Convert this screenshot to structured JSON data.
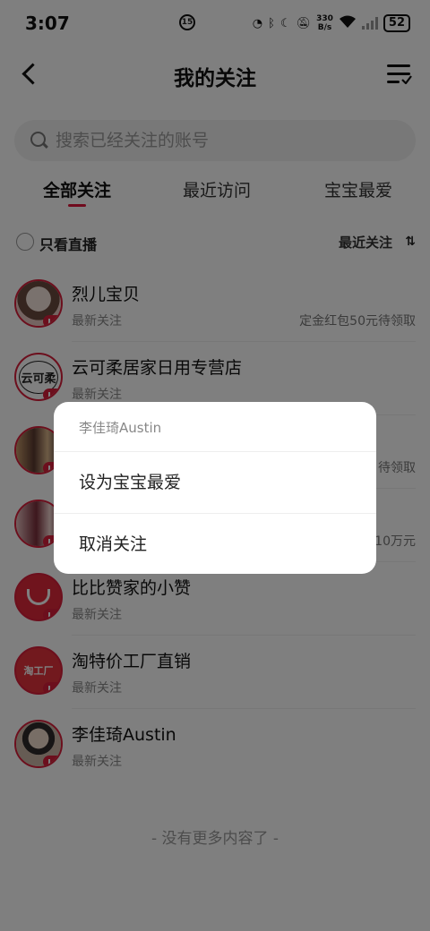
{
  "status_bar": {
    "time": "3:07",
    "center_icon_text": "15",
    "net_speed_value": "330",
    "net_speed_unit": "B/s",
    "battery": "52"
  },
  "nav": {
    "title": "我的关注"
  },
  "search": {
    "placeholder": "搜索已经关注的账号"
  },
  "tabs": [
    {
      "label": "全部关注",
      "active": true
    },
    {
      "label": "最近访问",
      "active": false
    },
    {
      "label": "宝宝最爱",
      "active": false
    }
  ],
  "filter": {
    "live_only_label": "只看直播",
    "sort_label": "最近关注"
  },
  "follow_list": [
    {
      "name": "烈儿宝贝",
      "sub": "最新关注",
      "promo": "定金红包50元待领取",
      "avatar_color": "#e9c9c3"
    },
    {
      "name": "云可柔居家日用专营店",
      "sub": "最新关注",
      "promo": "",
      "avatar_color": "#ffffff",
      "avatar_text": "云可柔"
    },
    {
      "name": "",
      "sub": "",
      "promo": "待领取",
      "avatar_color": "#8a6a55"
    },
    {
      "name": "",
      "sub": "",
      "promo": "10万元",
      "avatar_color": "#7a4a50"
    },
    {
      "name": "比比赞家的小赞",
      "sub": "最新关注",
      "promo": "",
      "avatar_color": "#e0283a"
    },
    {
      "name": "淘特价工厂直销",
      "sub": "最新关注",
      "promo": "",
      "avatar_color": "#e4323c",
      "avatar_text": "淘工厂"
    },
    {
      "name": "李佳琦Austin",
      "sub": "最新关注",
      "promo": "",
      "avatar_color": "#cdb9a8"
    }
  ],
  "footer_text": "- 没有更多内容了 -",
  "action_sheet": {
    "title": "李佳琦Austin",
    "items": [
      "设为宝宝最爱",
      "取消关注"
    ]
  },
  "colors": {
    "accent": "#e0153a",
    "overlay": "rgba(0,0,0,0.5)"
  }
}
